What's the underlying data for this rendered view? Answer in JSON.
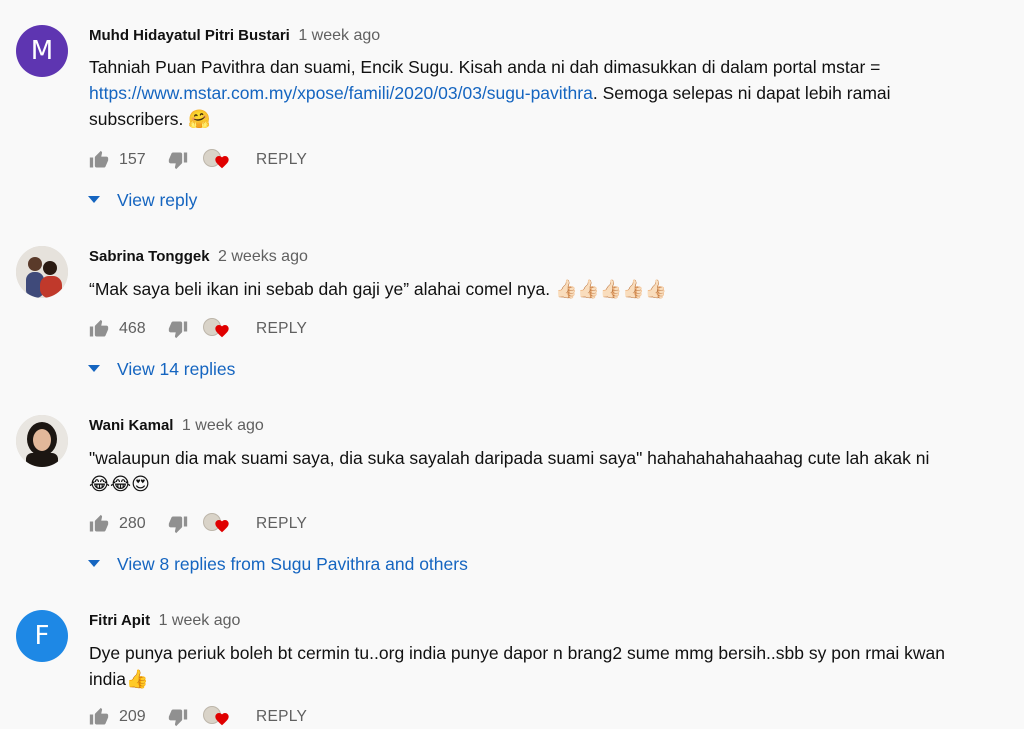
{
  "comments": [
    {
      "author": "Muhd Hidayatul Pitri Bustari",
      "time": "1 week ago",
      "avatar_letter": "M",
      "avatar_color": "#5e35b1",
      "text_before_link": "Tahniah Puan Pavithra dan suami, Encik Sugu. Kisah anda ni dah dimasukkan di dalam portal mstar = ",
      "link": "https://www.mstar.com.my/xpose/famili/2020/03/03/sugu-pavithra",
      "text_after_link": ". Semoga selepas ni dapat lebih ramai subscribers. ",
      "emoji": "🤗",
      "likes": "157",
      "reply_label": "REPLY",
      "view_replies": "View reply"
    },
    {
      "author": "Sabrina Tonggek",
      "time": "2 weeks ago",
      "text": "“Mak saya beli ikan ini sebab dah gaji ye” alahai comel nya. ",
      "emoji": "👍🏻👍🏻👍🏻👍🏻👍🏻",
      "likes": "468",
      "reply_label": "REPLY",
      "view_replies": "View 14 replies"
    },
    {
      "author": "Wani Kamal",
      "time": "1 week ago",
      "text": "\"walaupun dia mak suami saya, dia suka sayalah daripada suami saya\" hahahahahahaahag cute lah akak ni ",
      "emoji": "😂😂😍",
      "likes": "280",
      "reply_label": "REPLY",
      "view_replies": "View 8 replies from Sugu Pavithra and others"
    },
    {
      "author": "Fitri Apit",
      "time": "1 week ago",
      "avatar_letter": "F",
      "avatar_color": "#1e88e5",
      "text": "Dye punya periuk boleh bt cermin tu..org india punye dapor n brang2 sume mmg bersih..sbb sy pon rmai kwan india",
      "emoji": "👍",
      "likes": "209",
      "reply_label": "REPLY"
    }
  ],
  "icons": {
    "like": "thumbs-up-icon",
    "dislike": "thumbs-down-icon",
    "creator_heart": "creator-heart-icon",
    "expand": "caret-down-icon"
  },
  "colors": {
    "link": "#1565c0",
    "heart": "#e00000",
    "meta": "#606060"
  }
}
